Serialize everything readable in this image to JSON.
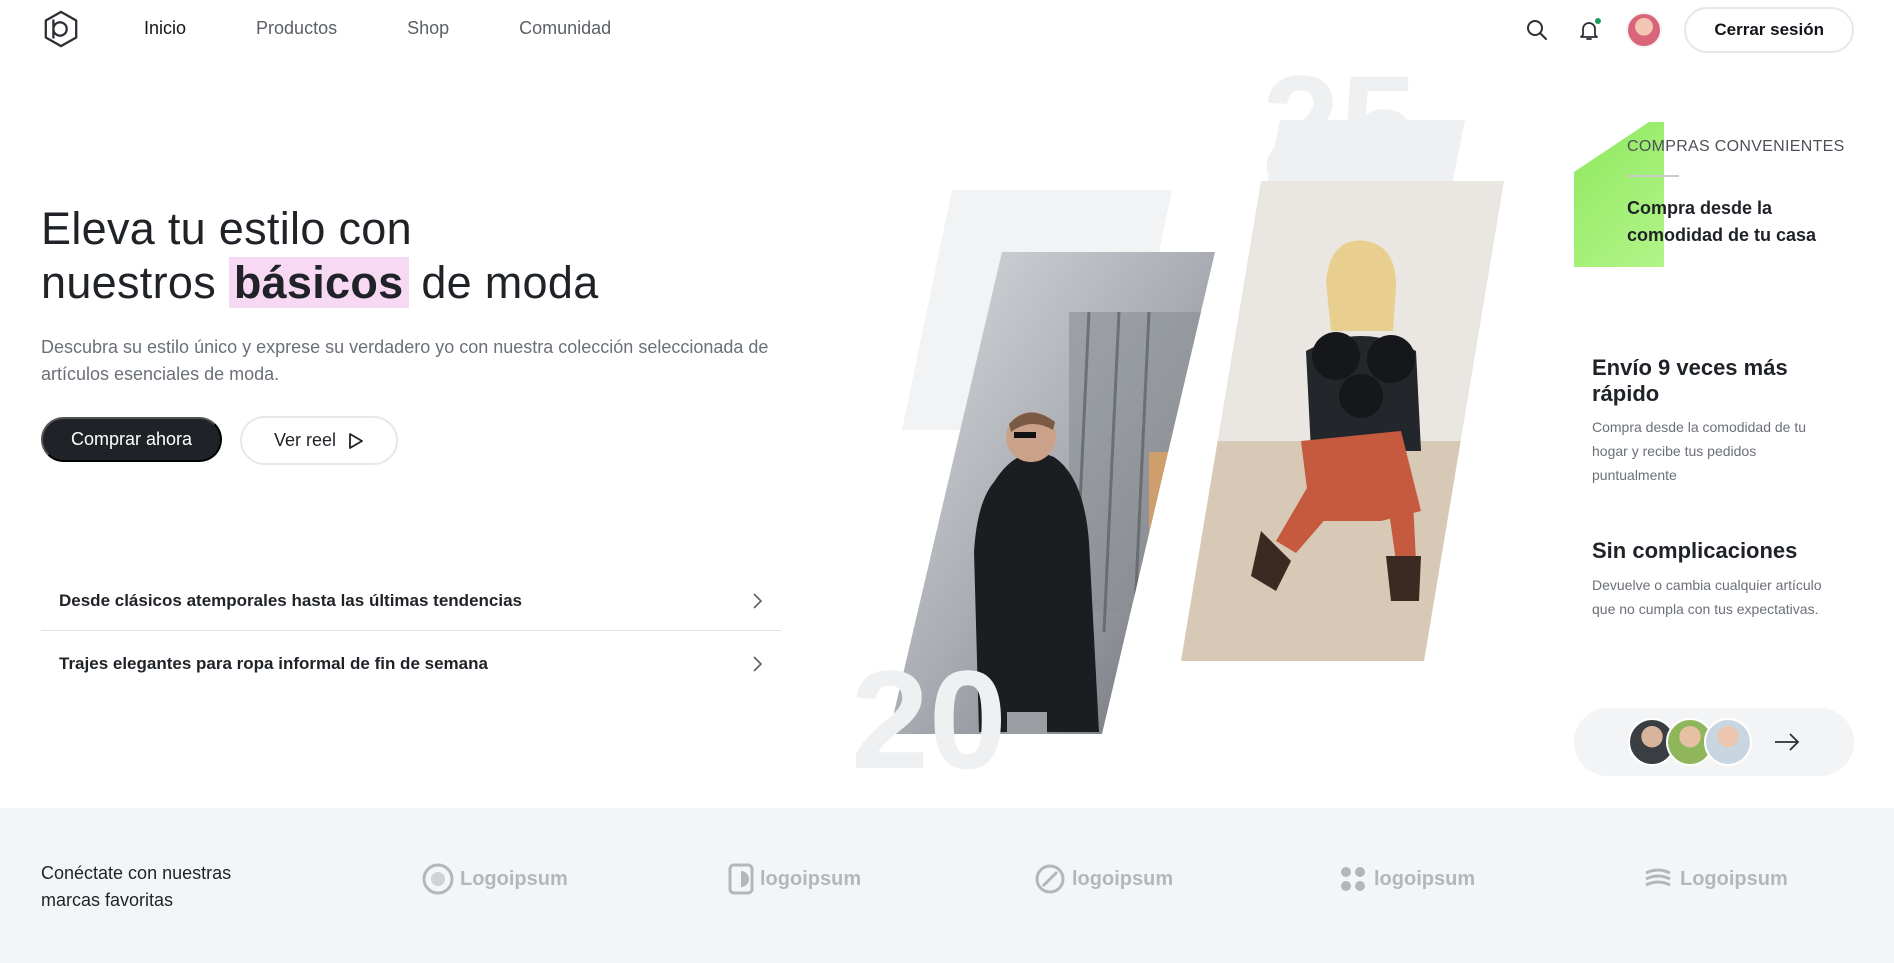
{
  "header": {
    "nav": [
      "Inicio",
      "Productos",
      "Shop",
      "Comunidad"
    ],
    "active_nav": "Inicio",
    "logout_label": "Cerrar sesión"
  },
  "hero": {
    "title_line1": "Eleva tu estilo con",
    "title_pre": "nuestros",
    "title_highlight": "básicos",
    "title_post": "de moda",
    "description": "Descubra su estilo único y exprese su verdadero yo con nuestra colección seleccionada de artículos esenciales de moda.",
    "primary_label": "Comprar ahora",
    "secondary_label": "Ver reel",
    "accordion": [
      "Desde clásicos atemporales hasta las últimas tendencias",
      "Trajes elegantes para ropa informal de fin de semana"
    ],
    "numbers": [
      "25",
      "20"
    ]
  },
  "features": {
    "overline": "COMPRAS CONVENIENTES",
    "highlight": "Compra desde la comodidad de tu casa",
    "items": [
      {
        "title": "Envío 9 veces más rápido",
        "text": "Compra desde la comodidad de tu hogar y recibe tus pedidos puntualmente"
      },
      {
        "title": "Sin complicaciones",
        "text": "Devuelve o cambia cualquier artículo que no cumpla con tus expectativas."
      }
    ]
  },
  "brands": {
    "text": "Conéctate con nuestras marcas favoritas",
    "logos": [
      "Logoipsum",
      "logoipsum",
      "logoipsum",
      "logoipsum",
      "Logoipsum"
    ]
  },
  "colors": {
    "primary": "#1f2328",
    "highlight": "#f7d9f3",
    "accent_green": "#8fe85e",
    "notification": "#1a9e5c"
  }
}
